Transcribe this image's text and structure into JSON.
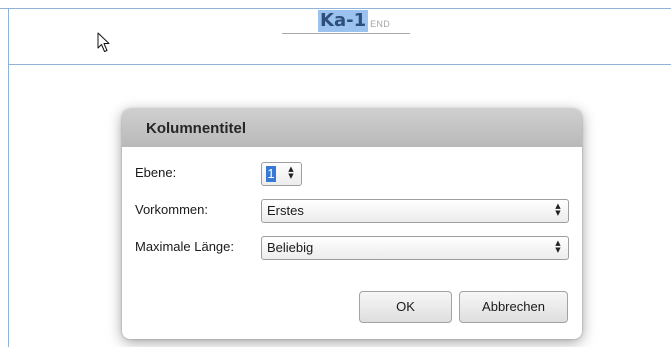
{
  "document": {
    "running_head_text": "Ka-1",
    "running_head_marker": "END"
  },
  "dialog": {
    "title": "Kolumnentitel",
    "level": {
      "label": "Ebene:",
      "value": "1"
    },
    "occurrence": {
      "label": "Vorkommen:",
      "value": "Erstes"
    },
    "max_length": {
      "label": "Maximale Länge:",
      "value": "Beliebig"
    },
    "ok_label": "OK",
    "cancel_label": "Abbrechen"
  },
  "icons": {
    "cursor": "arrow-pointer-icon",
    "spinner": "up-down-arrows-icon",
    "select": "up-down-arrows-icon"
  },
  "colors": {
    "selection_highlight": "#9cc3ef",
    "page_frame": "#8fb3d9",
    "field_selection": "#3979d6",
    "dialog_title_bg": "#c3c3c3"
  }
}
